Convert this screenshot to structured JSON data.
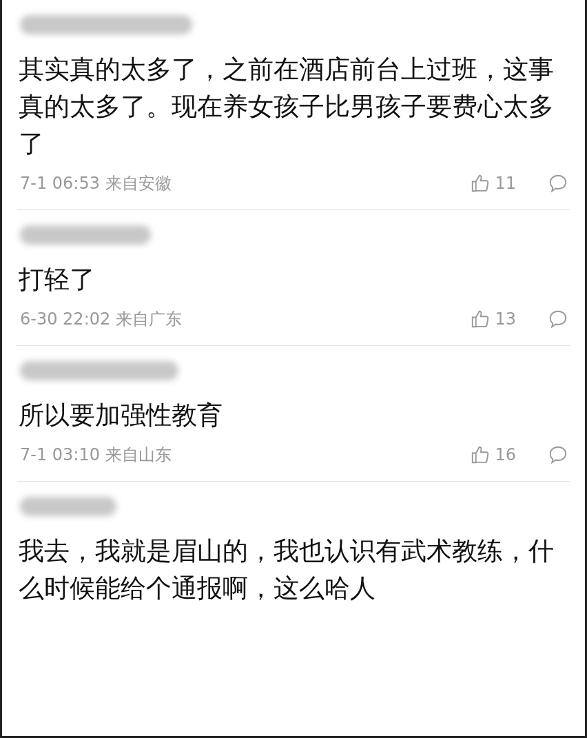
{
  "comments": [
    {
      "text": "其实真的太多了，之前在酒店前台上过班，这事真的太多了。现在养女孩子比男孩子要费心太多了",
      "time": "7-1 06:53 来自安徽",
      "likes": "11"
    },
    {
      "text": "打轻了",
      "time": "6-30 22:02 来自广东",
      "likes": "13"
    },
    {
      "text": "所以要加强性教育",
      "time": "7-1 03:10 来自山东",
      "likes": "16"
    },
    {
      "text": "我去，我就是眉山的，我也认识有武术教练，什么时候能给个通报啊，这么哈人"
    }
  ]
}
